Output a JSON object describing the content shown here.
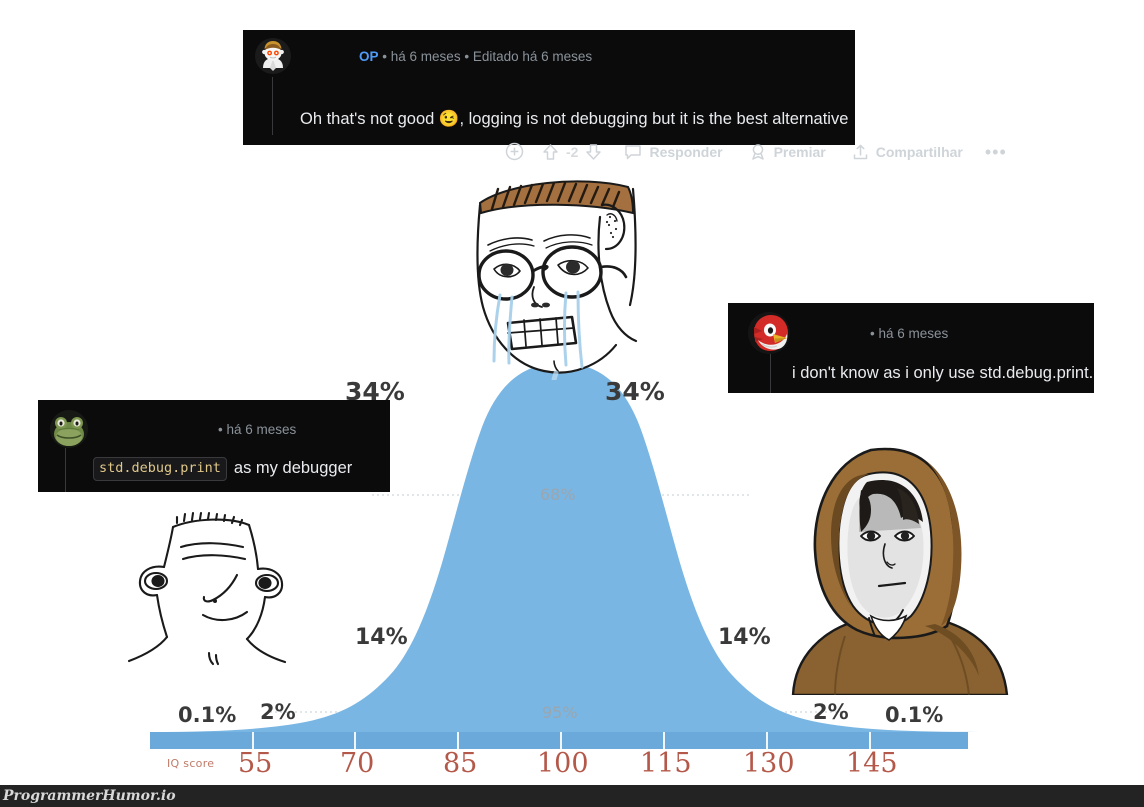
{
  "meme": {
    "watermark": "ProgrammerHumor.io",
    "background_color": "#ffffff"
  },
  "comments": [
    {
      "id": "top-comment",
      "author_tag": "OP",
      "sep1": "•",
      "time": "há 6 meses",
      "sep2": "•",
      "edited": "Editado há 6 meses",
      "body_prefix": "Oh that's not good ",
      "emoji": "😉",
      "body_suffix": ", logging is not debugging but it is the best alternative",
      "avatar": "snoo-scientist-avatar",
      "actions": {
        "add_label": "add-reaction",
        "upvote_label": "upvote",
        "score": "-2",
        "downvote_label": "downvote",
        "reply": "Responder",
        "award": "Premiar",
        "share": "Compartilhar",
        "more": "•••"
      }
    },
    {
      "id": "left-comment",
      "sep1": "•",
      "time": "há 6 meses",
      "code": "std.debug.print",
      "body_suffix": " as my debugger",
      "avatar": "frog-avatar"
    },
    {
      "id": "right-comment",
      "sep1": "•",
      "time": "há 6 meses",
      "body": "i don't know as i only use std.debug.print.",
      "avatar": "red-bird-avatar"
    }
  ],
  "chart_data": {
    "type": "area",
    "title": "",
    "xlabel": "IQ score",
    "ylabel": "",
    "distribution": "normal",
    "mean": 100,
    "std_dev": 15,
    "categories": [
      "55",
      "70",
      "85",
      "100",
      "115",
      "130",
      "145"
    ],
    "x": [
      55,
      70,
      85,
      100,
      115,
      130,
      145
    ],
    "xlim": [
      40,
      160
    ],
    "grid": true,
    "legend": null,
    "band_labels": [
      {
        "label": "0.1%",
        "position": "far-left",
        "value": 0.1
      },
      {
        "label": "2%",
        "position": "left-2",
        "value": 2
      },
      {
        "label": "14%",
        "position": "left-1",
        "value": 14
      },
      {
        "label": "34%",
        "position": "center-left",
        "value": 34
      },
      {
        "label": "34%",
        "position": "center-right",
        "value": 34
      },
      {
        "label": "14%",
        "position": "right-1",
        "value": 14
      },
      {
        "label": "2%",
        "position": "right-2",
        "value": 2
      },
      {
        "label": "0.1%",
        "position": "far-right",
        "value": 0.1
      }
    ],
    "interval_labels": [
      {
        "label": "68%",
        "value": 68,
        "span": [
          85,
          115
        ]
      },
      {
        "label": "95%",
        "value": 95,
        "span": [
          70,
          130
        ]
      }
    ],
    "curve_color": "#79b6e3",
    "tick_color": "#b4594a",
    "axis_label_color": "#c07a68"
  },
  "wojaks": [
    {
      "name": "brainlet-wojak",
      "position": "left",
      "description": "low IQ wojak"
    },
    {
      "name": "crying-soyjak",
      "position": "center",
      "description": "crying wojak with glasses"
    },
    {
      "name": "jedi-hood-wojak",
      "position": "right",
      "description": "enlightened hooded wojak"
    }
  ]
}
